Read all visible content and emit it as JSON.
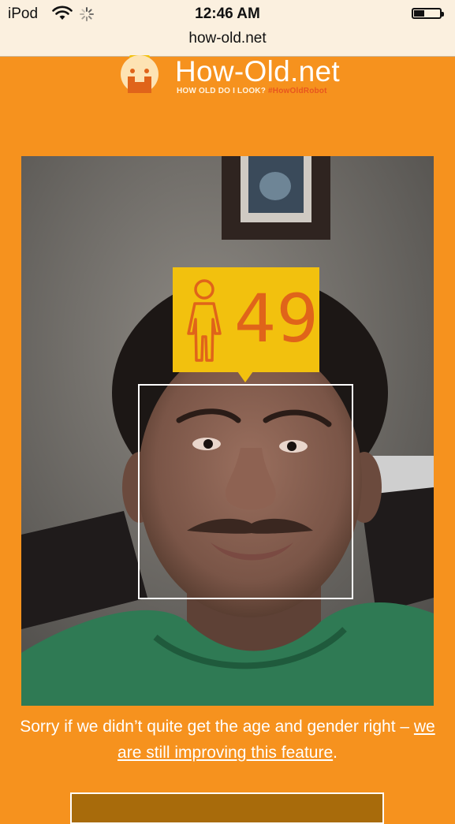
{
  "status_bar": {
    "device": "iPod",
    "time": "12:46 AM",
    "battery_level": 0.4
  },
  "browser": {
    "url": "how-old.net"
  },
  "site": {
    "title": "How-Old.net",
    "tagline": "HOW OLD DO I LOOK?",
    "hashtag": "#HowOldRobot"
  },
  "result": {
    "age": "49",
    "gender_icon": "male-person-icon"
  },
  "disclaimer": {
    "text_before": "Sorry if we didn’t quite get the age and gender right – ",
    "link_text": "we are still improving this feature",
    "text_after": "."
  },
  "colors": {
    "page_background": "#f6921e",
    "tag_yellow": "#f2c10e",
    "tag_text": "#e0641a",
    "hashtag": "#e8561f"
  }
}
